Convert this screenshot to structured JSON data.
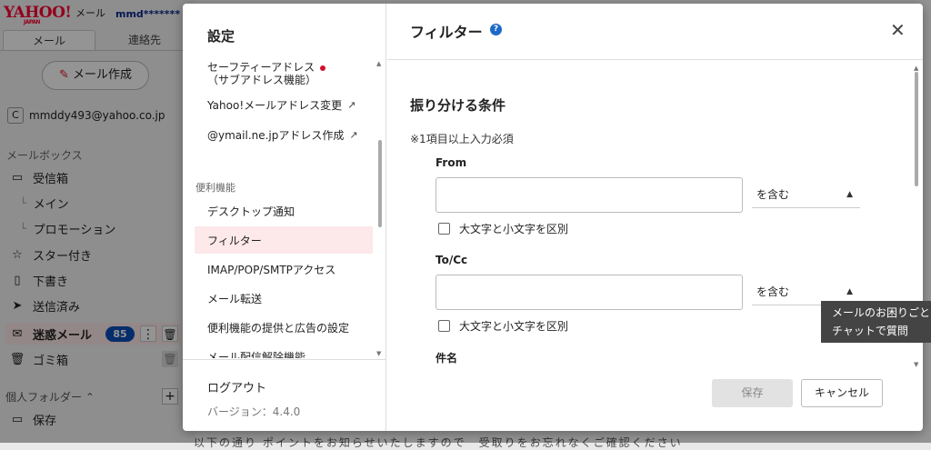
{
  "app": {
    "logo": "YAHOO!",
    "logo_sub": "JAPAN",
    "logo_mail": "メール",
    "user_name": "mmd*******"
  },
  "tabs": [
    "メール",
    "連絡先"
  ],
  "compose_label": "メール作成",
  "account_email": "mmddy493@yahoo.co.jp",
  "mailbox_title": "メールボックス",
  "folders": {
    "inbox": "受信箱",
    "main": "メイン",
    "promotion": "プロモーション",
    "starred": "スター付き",
    "drafts": "下書き",
    "sent": "送信済み",
    "spam": "迷惑メール",
    "spam_count": "85",
    "trash": "ゴミ箱"
  },
  "personal_folders": "個人フォルダー",
  "personal_folder_item": "保存",
  "bottom_text": "以下の通り ポイントをお知らせいたしますので　受取りをお忘れなくご確認ください",
  "settings": {
    "title": "設定",
    "nav": {
      "safety_address": "セーフティーアドレス",
      "safety_address_sub": "（サブアドレス機能）",
      "change_address": "Yahoo!メールアドレス変更",
      "ymail_address": "@ymail.ne.jpアドレス作成",
      "section_useful": "便利機能",
      "desktop_notify": "デスクトップ通知",
      "filter": "フィルター",
      "imap": "IMAP/POP/SMTPアクセス",
      "forward": "メール転送",
      "ads": "便利機能の提供と広告の設定",
      "unsubscribe": "メール配信解除機能"
    },
    "logout": "ログアウト",
    "version": "バージョン：4.4.0"
  },
  "filter": {
    "title": "フィルター",
    "section_title": "振り分ける条件",
    "required_note": "※1項目以上入力必須",
    "from_label": "From",
    "to_label": "To/Cc",
    "subject_label": "件名",
    "from_value": "",
    "to_value": "",
    "match_option": "を含む",
    "case_sensitive_label": "大文字と小文字を区別",
    "save_label": "保存",
    "cancel_label": "キャンセル"
  },
  "tooltip": {
    "line1": "メールのお困りごとは",
    "line2": "チャットで質問"
  }
}
